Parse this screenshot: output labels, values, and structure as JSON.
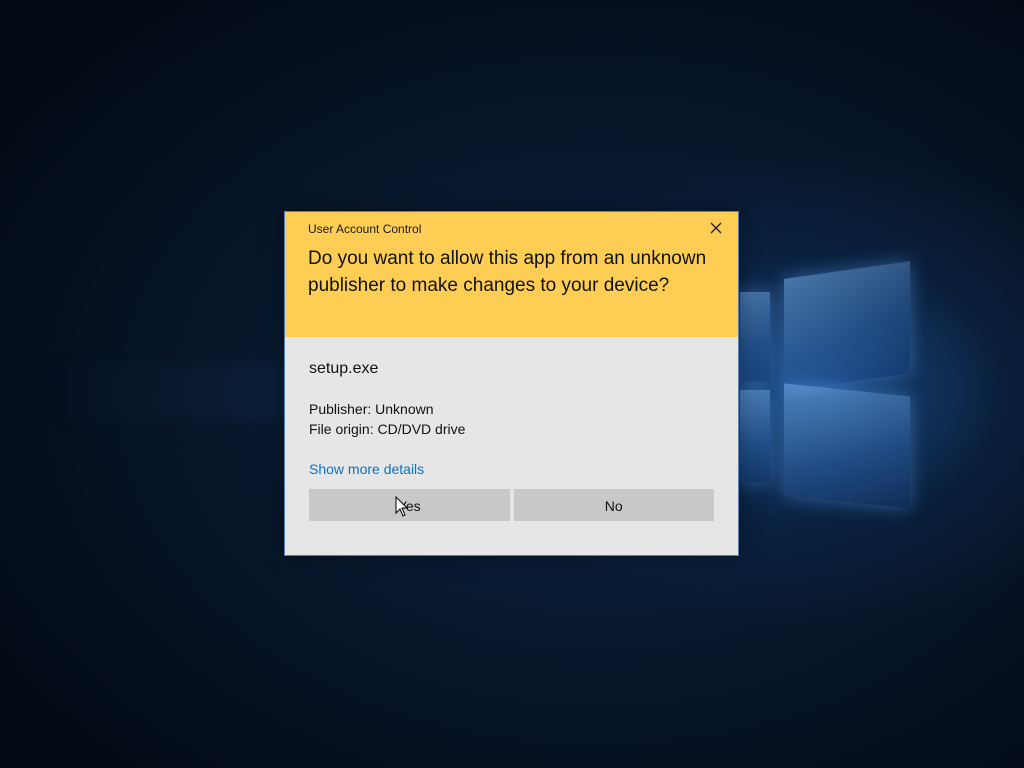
{
  "dialog": {
    "title": "User Account Control",
    "question": "Do you want to allow this app from an unknown publisher to make changes to your device?",
    "app_name": "setup.exe",
    "publisher": "Publisher: Unknown",
    "file_origin": "File origin: CD/DVD drive",
    "details_link": "Show more details",
    "yes_label": "Yes",
    "no_label": "No",
    "close_icon": "close-icon",
    "header_color": "#fdce53",
    "link_color": "#0b71c2"
  },
  "desktop": {
    "logo_icon": "windows-logo-icon",
    "cursor_icon": "mouse-pointer-icon"
  }
}
